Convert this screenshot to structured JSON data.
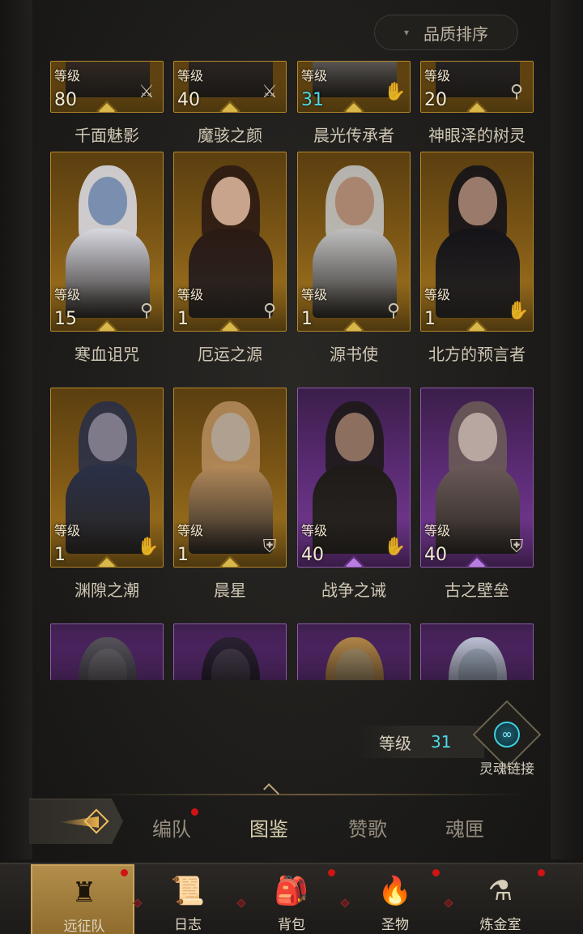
{
  "sort_button": {
    "caret": "▾",
    "label": "品质排序"
  },
  "level_label_text": "等级",
  "cards": [
    {
      "name": "千面魅影",
      "level": "80",
      "rarity": "gold",
      "role": "sword",
      "level_color": "white"
    },
    {
      "name": "魔骇之颜",
      "level": "40",
      "rarity": "gold",
      "role": "sword",
      "level_color": "white"
    },
    {
      "name": "晨光传承者",
      "level": "31",
      "rarity": "gold",
      "role": "hand",
      "level_color": "cyan"
    },
    {
      "name": "神眼泽的树灵",
      "level": "20",
      "rarity": "gold",
      "role": "staff",
      "level_color": "white"
    },
    {
      "name": "寒血诅咒",
      "level": "15",
      "rarity": "gold",
      "role": "staff",
      "level_color": "white"
    },
    {
      "name": "厄运之源",
      "level": "1",
      "rarity": "gold",
      "role": "staff",
      "level_color": "white"
    },
    {
      "name": "源书使",
      "level": "1",
      "rarity": "gold",
      "role": "staff",
      "level_color": "white"
    },
    {
      "name": "北方的预言者",
      "level": "1",
      "rarity": "gold",
      "role": "hand",
      "level_color": "white"
    },
    {
      "name": "渊隙之潮",
      "level": "1",
      "rarity": "gold",
      "role": "hand",
      "level_color": "white"
    },
    {
      "name": "晨星",
      "level": "1",
      "rarity": "gold",
      "role": "shield",
      "level_color": "white"
    },
    {
      "name": "战争之诫",
      "level": "40",
      "rarity": "purple",
      "role": "hand",
      "level_color": "white"
    },
    {
      "name": "古之壁垒",
      "level": "40",
      "rarity": "purple",
      "role": "shield",
      "level_color": "white"
    },
    {
      "name": "",
      "level": "",
      "rarity": "purple",
      "role": "",
      "level_color": "white"
    },
    {
      "name": "",
      "level": "",
      "rarity": "purple",
      "role": "",
      "level_color": "white"
    },
    {
      "name": "",
      "level": "",
      "rarity": "purple",
      "role": "",
      "level_color": "white"
    },
    {
      "name": "",
      "level": "",
      "rarity": "purple",
      "role": "",
      "level_color": "white"
    }
  ],
  "soul_panel": {
    "level_label": "等级",
    "level_value": "31",
    "link_label": "灵魂链接"
  },
  "subtabs": [
    {
      "label": "编队",
      "active": false,
      "badge": true
    },
    {
      "label": "图鉴",
      "active": true,
      "badge": false
    },
    {
      "label": "赞歌",
      "active": false,
      "badge": false
    },
    {
      "label": "魂匣",
      "active": false,
      "badge": false
    }
  ],
  "bottom_nav": [
    {
      "label": "远征队",
      "icon": "viking-helmet-icon",
      "active": true,
      "badge": true
    },
    {
      "label": "日志",
      "icon": "scroll-icon",
      "active": false,
      "badge": false
    },
    {
      "label": "背包",
      "icon": "backpack-icon",
      "active": false,
      "badge": true
    },
    {
      "label": "圣物",
      "icon": "torch-icon",
      "active": false,
      "badge": true
    },
    {
      "label": "炼金室",
      "icon": "alchemy-icon",
      "active": false,
      "badge": true
    }
  ],
  "colors": {
    "gold_frame": "#b7892b",
    "purple_frame": "#8e5aaa",
    "cyan_accent": "#4ed8e6",
    "badge_red": "#d01414"
  }
}
